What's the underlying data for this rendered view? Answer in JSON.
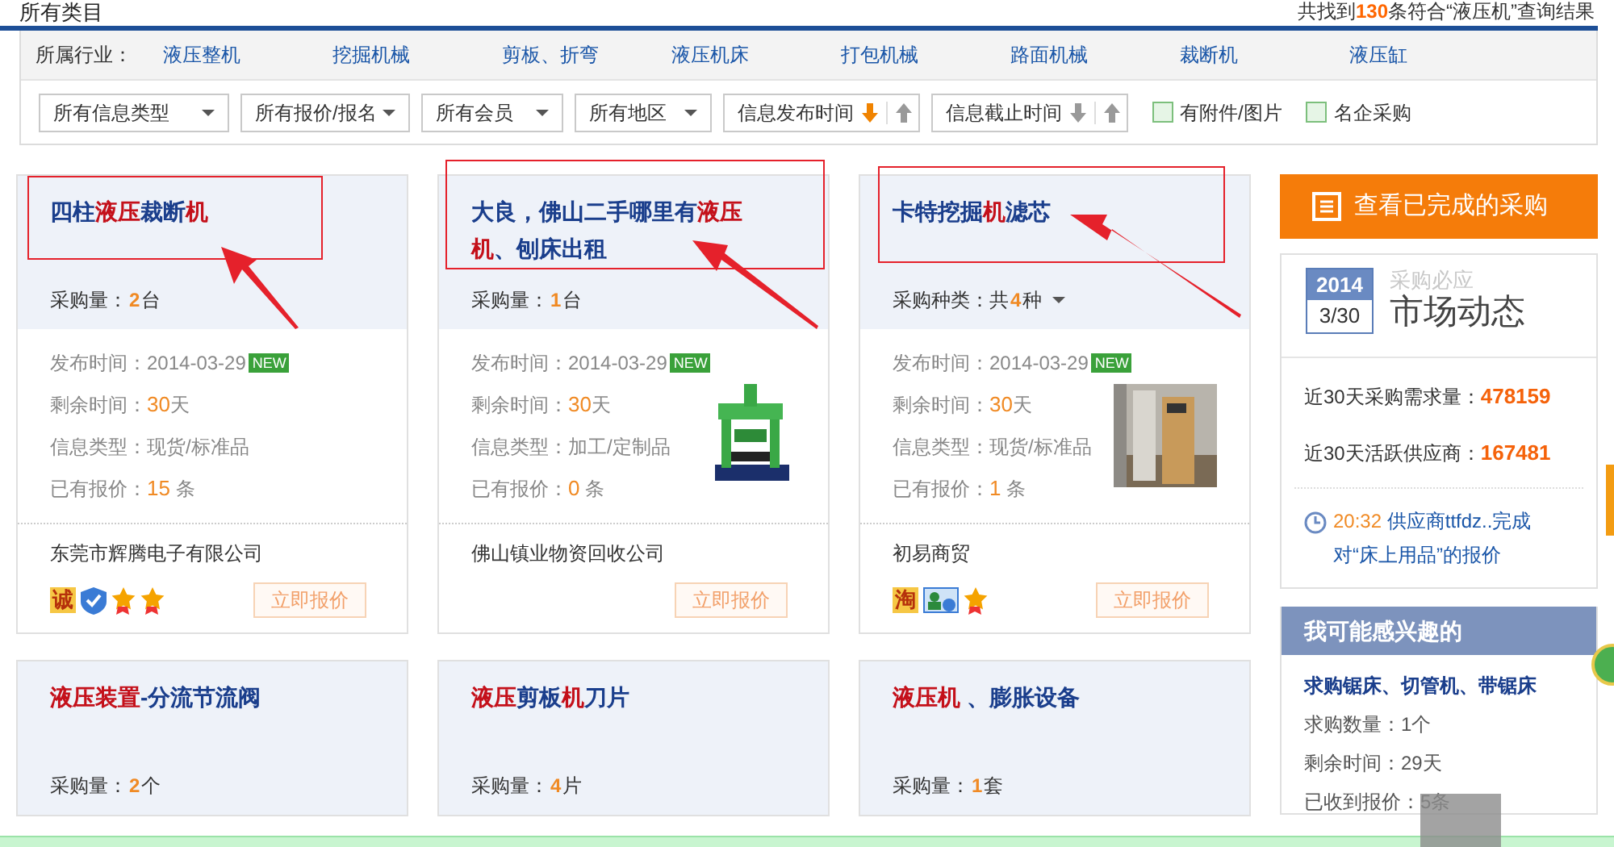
{
  "header": {
    "category": "所有类目",
    "result_text": "共找到",
    "result_count": "130",
    "result_suffix": "条符合“液压机”查询结果"
  },
  "industry": {
    "label": "所属行业：",
    "links": [
      "液压整机",
      "挖掘机械",
      "剪板、折弯",
      "液压机床",
      "打包机械",
      "路面机械",
      "裁断机",
      "液压缸"
    ]
  },
  "filters": [
    {
      "kind": "select",
      "label": "所有信息类型"
    },
    {
      "kind": "select",
      "label": "所有报价/报名"
    },
    {
      "kind": "select",
      "label": "所有会员"
    },
    {
      "kind": "select",
      "label": "所有地区"
    },
    {
      "kind": "sort",
      "label": "信息发布时间",
      "down_active": true
    },
    {
      "kind": "sort",
      "label": "信息截止时间",
      "down_active": false
    },
    {
      "kind": "checkbox",
      "label": "有附件/图片",
      "checked": false
    },
    {
      "kind": "checkbox",
      "label": "名企采购",
      "checked": false
    }
  ],
  "cards": [
    {
      "title_parts": [
        {
          "text": "四柱",
          "highlight": false
        },
        {
          "text": "液压",
          "highlight": true
        },
        {
          "text": "裁断",
          "highlight": false
        },
        {
          "text": "机",
          "highlight": true
        }
      ],
      "qty_label": "采购量：",
      "qty_value": "2",
      "qty_unit": "台",
      "caret": false,
      "publish_label": "发布时间：",
      "publish_date": "2014-03-29",
      "new_badge": "NEW",
      "remain_label": "剩余时间：",
      "remain_value": "30",
      "remain_unit": "天",
      "type_label": "信息类型：",
      "type_value": "现货/标准品",
      "quotes_label": "已有报价：",
      "quotes_value": "15",
      "quotes_unit": "条",
      "company": "东莞市辉腾电子有限公司",
      "badges": [
        {
          "kind": "char",
          "text": "诚"
        },
        {
          "kind": "shield"
        },
        {
          "kind": "medal"
        },
        {
          "kind": "medal"
        }
      ],
      "button": "立即报价"
    },
    {
      "title_parts": [
        {
          "text": "大良，佛山二手哪里有",
          "highlight": false
        },
        {
          "text": "液压机",
          "highlight": true
        },
        {
          "text": "、刨床出租",
          "highlight": false
        }
      ],
      "qty_label": "采购量：",
      "qty_value": "1",
      "qty_unit": "台",
      "caret": false,
      "publish_label": "发布时间：",
      "publish_date": "2014-03-29",
      "new_badge": "NEW",
      "remain_label": "剩余时间：",
      "remain_value": "30",
      "remain_unit": "天",
      "type_label": "信息类型：",
      "type_value": "加工/定制品",
      "quotes_label": "已有报价：",
      "quotes_value": "0",
      "quotes_unit": "条",
      "has_picture": true,
      "company": "佛山镇业物资回收公司",
      "button": "立即报价"
    },
    {
      "title_parts": [
        {
          "text": "卡特挖掘",
          "highlight": false
        },
        {
          "text": "机",
          "highlight": true
        },
        {
          "text": "滤芯",
          "highlight": false
        }
      ],
      "qty_label": "采购种类：共",
      "qty_value": "4",
      "qty_unit": "种",
      "caret": true,
      "publish_label": "发布时间：",
      "publish_date": "2014-03-29",
      "new_badge": "NEW",
      "remain_label": "剩余时间：",
      "remain_value": "30",
      "remain_unit": "天",
      "type_label": "信息类型：",
      "type_value": "现货/标准品",
      "quotes_label": "已有报价：",
      "quotes_value": "1",
      "quotes_unit": "条",
      "has_picture": true,
      "company": "初易商贸",
      "badges": [
        {
          "kind": "char",
          "text": "淘"
        },
        {
          "kind": "idcard"
        },
        {
          "kind": "medal"
        }
      ],
      "button": "立即报价"
    },
    {
      "title_parts": [
        {
          "text": "液压装置",
          "highlight": true
        },
        {
          "text": "-分流节流阀",
          "highlight": false
        }
      ],
      "qty_label": "采购量：",
      "qty_value": "2",
      "qty_unit": "个",
      "caret": false
    },
    {
      "title_parts": [
        {
          "text": "液压",
          "highlight": true
        },
        {
          "text": "剪板",
          "highlight": false
        },
        {
          "text": "机",
          "highlight": true
        },
        {
          "text": "刀片",
          "highlight": false
        }
      ],
      "qty_label": "采购量：",
      "qty_value": "4",
      "qty_unit": "片",
      "caret": false
    },
    {
      "title_parts": [
        {
          "text": "液压机",
          "highlight": true
        },
        {
          "text": " 、膨胀设备",
          "highlight": false
        }
      ],
      "qty_label": "采购量：",
      "qty_value": "1",
      "qty_unit": "套",
      "caret": false
    }
  ],
  "sidebar": {
    "completed_button": "查看已完成的采购",
    "market": {
      "year": "2014",
      "date": "3/30",
      "subtitle": "采购必应",
      "title": "市场动态",
      "stats": [
        {
          "label": "近30天采购需求量：",
          "value": "478159"
        },
        {
          "label": "近30天活跃供应商：",
          "value": "167481"
        }
      ],
      "feed_time": "20:32",
      "feed_text": "供应商ttfdz..完成对“床上用品”的报价"
    },
    "interest": {
      "header": "我可能感兴趣的",
      "item_title": "求购锯床、切管机、带锯床",
      "lines": [
        "求购数量：1个",
        "剩余时间：29天",
        "已收到报价：5条"
      ]
    }
  }
}
